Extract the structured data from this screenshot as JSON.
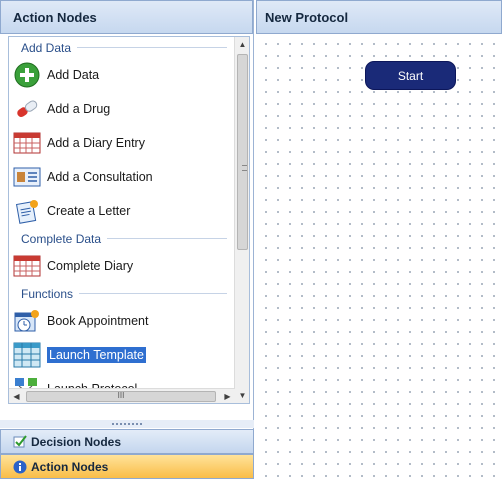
{
  "left_panel": {
    "title": "Action Nodes",
    "sections": [
      {
        "label": "Add Data",
        "items": [
          {
            "label": "Add Data",
            "icon": "add-green-icon"
          },
          {
            "label": "Add a Drug",
            "icon": "pill-icon"
          },
          {
            "label": "Add a Diary Entry",
            "icon": "calendar-icon"
          },
          {
            "label": "Add a Consultation",
            "icon": "consultation-card-icon"
          },
          {
            "label": "Create a Letter",
            "icon": "letter-icon"
          }
        ]
      },
      {
        "label": "Complete Data",
        "items": [
          {
            "label": "Complete Diary",
            "icon": "calendar-icon"
          }
        ]
      },
      {
        "label": "Functions",
        "items": [
          {
            "label": "Book Appointment",
            "icon": "appointment-clock-icon"
          },
          {
            "label": "Launch Template",
            "icon": "grid-table-icon",
            "selected": true
          },
          {
            "label": "Launch Protocol",
            "icon": "protocol-nodes-icon"
          }
        ]
      }
    ],
    "hscroll_grip": "III"
  },
  "nav": {
    "decision_label": "Decision Nodes",
    "action_label": "Action Nodes"
  },
  "right_panel": {
    "title": "New Protocol",
    "start_node_label": "Start"
  },
  "colors": {
    "accent_blue": "#1a2a78",
    "selection": "#2f6fd0",
    "active_nav": "#f9bd48"
  }
}
